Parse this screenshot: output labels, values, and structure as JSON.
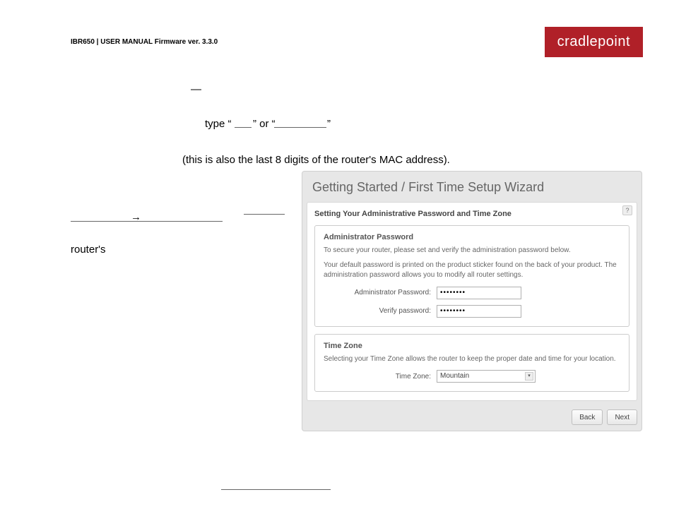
{
  "header": {
    "doc_title": "IBR650 | USER MANUAL Firmware ver. 3.3.0",
    "brand": "cradlepoint"
  },
  "body": {
    "em_dash": "—",
    "type_prefix": "type “",
    "type_mid": "” or “",
    "type_suffix": "”",
    "mac_line": "(this is also the last 8 digits of the router's MAC address).",
    "arrow": "→",
    "routers": "router's"
  },
  "wizard": {
    "title": "Getting Started / First Time Setup Wizard",
    "card_heading": "Setting Your Administrative Password and Time Zone",
    "help_char": "?",
    "admin": {
      "legend": "Administrator Password",
      "line1": "To secure your router, please set and verify the administration password below.",
      "line2": "Your default password is printed on the product sticker found on the back of your product. The administration password allows you to modify all router settings.",
      "label_pw": "Administrator Password:",
      "label_verify": "Verify password:",
      "value": "••••••••"
    },
    "tz": {
      "legend": "Time Zone",
      "line": "Selecting your Time Zone allows the router to keep the proper date and time for your location.",
      "label": "Time Zone:",
      "value": "Mountain"
    },
    "buttons": {
      "back": "Back",
      "next": "Next"
    }
  }
}
